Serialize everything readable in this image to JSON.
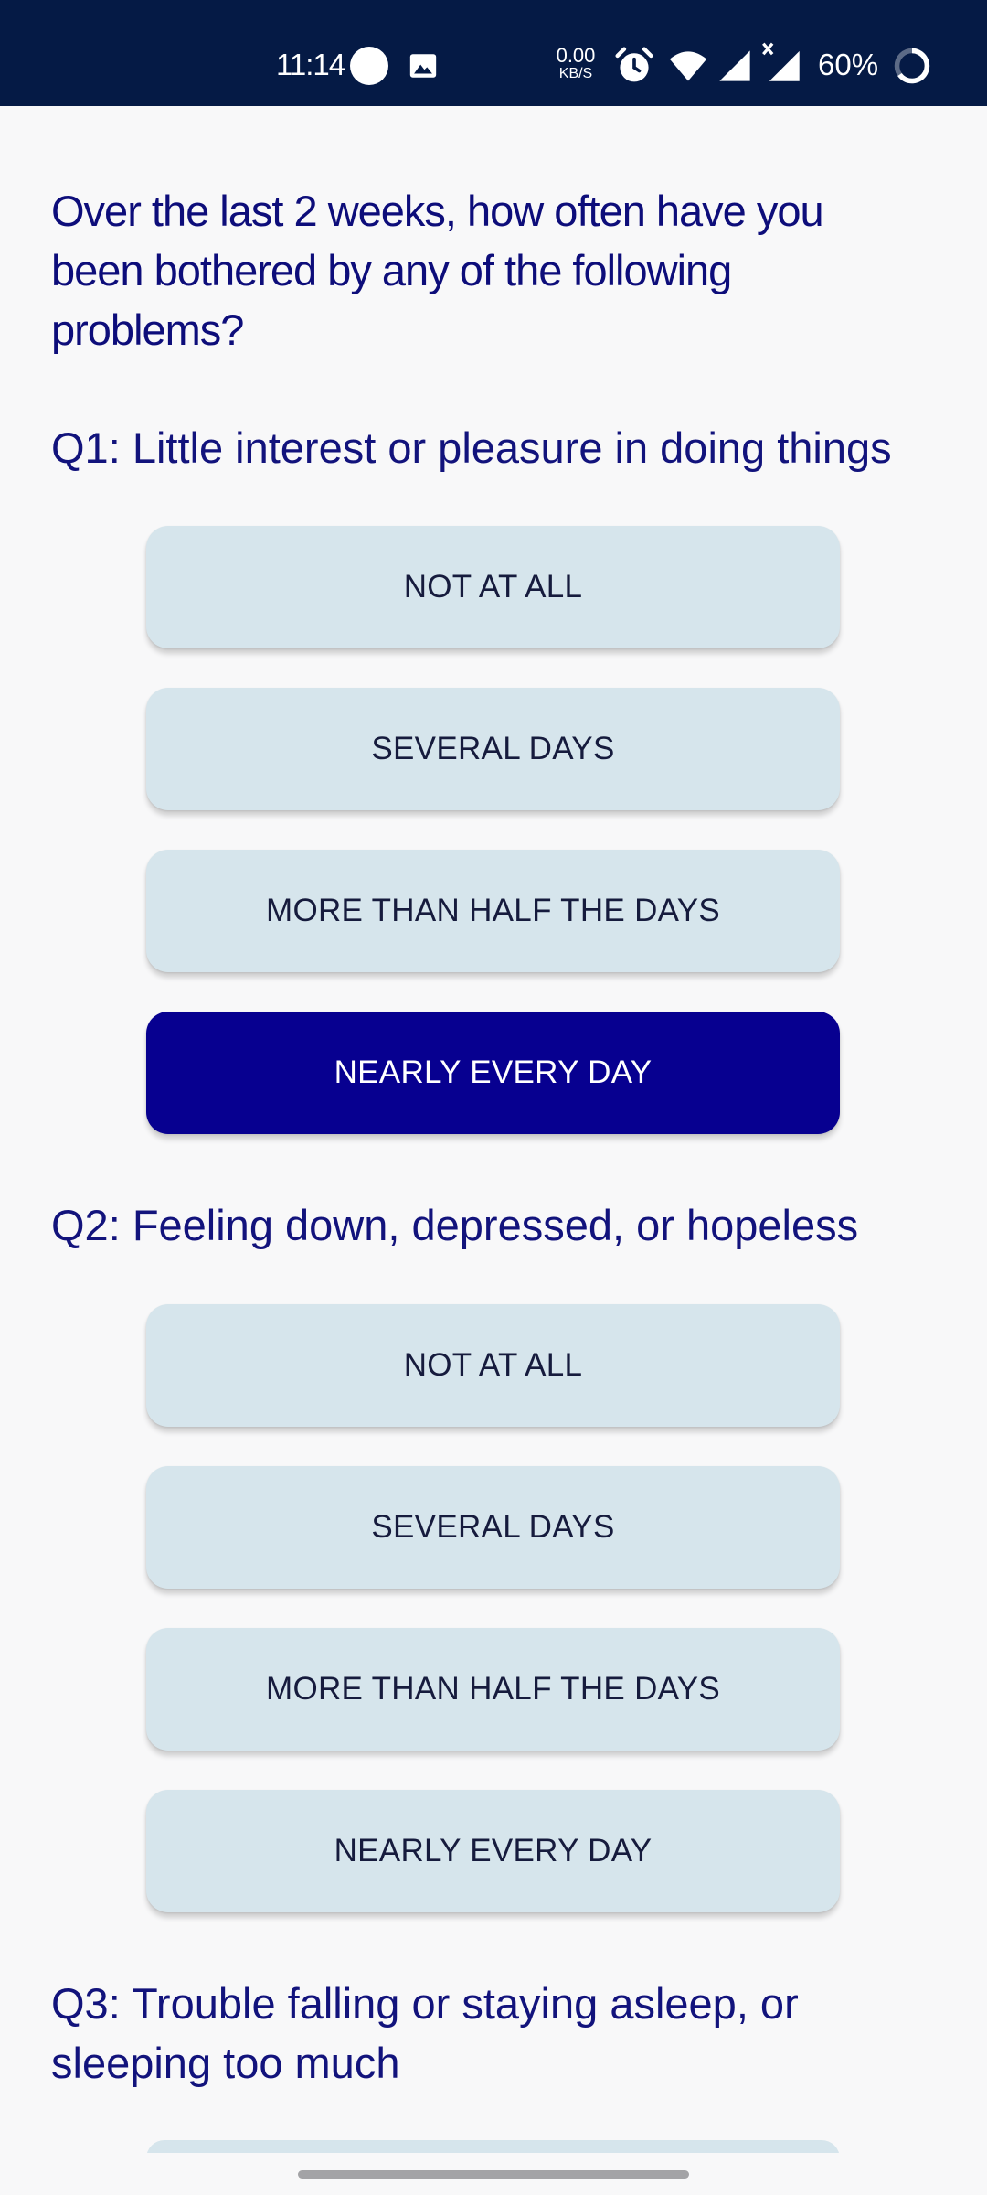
{
  "status_bar": {
    "time": "11:14",
    "net_rate": "0.00",
    "net_unit": "KB/S",
    "battery_percent": "60%",
    "icons": [
      "circle-notification-icon",
      "image-icon",
      "alarm-icon",
      "wifi-icon",
      "signal-icon",
      "signal-no-data-icon",
      "battery-ring-icon"
    ]
  },
  "survey": {
    "intro": "Over the last 2 weeks, how often have you been bothered by any of the following problems?",
    "questions": [
      {
        "label": "Q1: Little interest or pleasure in doing things",
        "options": [
          "NOT AT ALL",
          "SEVERAL DAYS",
          "MORE THAN HALF THE DAYS",
          "NEARLY EVERY DAY"
        ],
        "selected": "NEARLY EVERY DAY"
      },
      {
        "label": "Q2: Feeling down, depressed, or hopeless",
        "options": [
          "NOT AT ALL",
          "SEVERAL DAYS",
          "MORE THAN HALF THE DAYS",
          "NEARLY EVERY DAY"
        ],
        "selected": ""
      },
      {
        "label": "Q3: Trouble falling or staying asleep, or sleeping too much"
      }
    ]
  },
  "colors": {
    "status_bar_bg": "#051a45",
    "heading_text": "#0d0d7a",
    "option_bg": "#d6e5ec",
    "option_selected_bg": "#070090",
    "page_bg": "#f8f8f9"
  }
}
